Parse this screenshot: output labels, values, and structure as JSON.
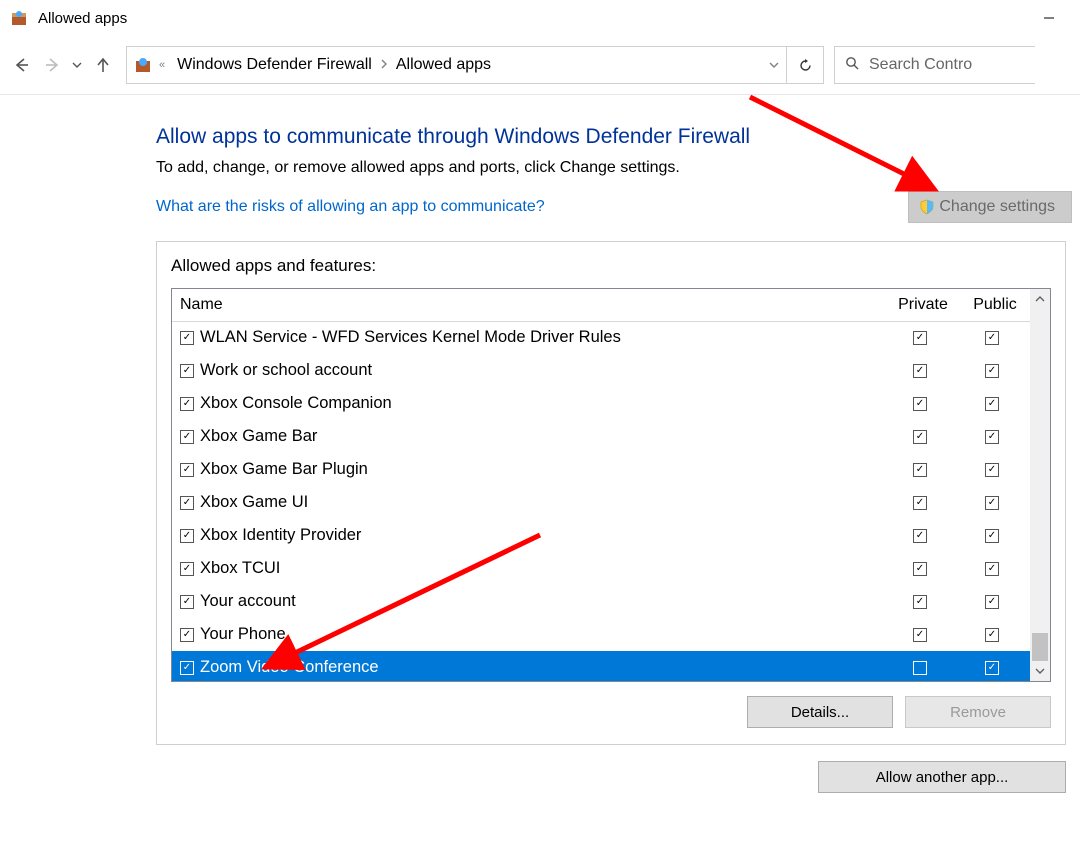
{
  "window": {
    "title": "Allowed apps"
  },
  "breadcrumb": {
    "item1": "Windows Defender Firewall",
    "item2": "Allowed apps"
  },
  "search": {
    "placeholder": "Search Contro"
  },
  "page": {
    "heading": "Allow apps to communicate through Windows Defender Firewall",
    "sub": "To add, change, or remove allowed apps and ports, click Change settings.",
    "risk_link": "What are the risks of allowing an app to communicate?",
    "change_settings": "Change settings"
  },
  "group": {
    "title": "Allowed apps and features:",
    "col_name": "Name",
    "col_private": "Private",
    "col_public": "Public"
  },
  "rows": [
    {
      "name": "WLAN Service - WFD Services Kernel Mode Driver Rules",
      "enabled": true,
      "private": true,
      "public": true,
      "selected": false
    },
    {
      "name": "Work or school account",
      "enabled": true,
      "private": true,
      "public": true,
      "selected": false
    },
    {
      "name": "Xbox Console Companion",
      "enabled": true,
      "private": true,
      "public": true,
      "selected": false
    },
    {
      "name": "Xbox Game Bar",
      "enabled": true,
      "private": true,
      "public": true,
      "selected": false
    },
    {
      "name": "Xbox Game Bar Plugin",
      "enabled": true,
      "private": true,
      "public": true,
      "selected": false
    },
    {
      "name": "Xbox Game UI",
      "enabled": true,
      "private": true,
      "public": true,
      "selected": false
    },
    {
      "name": "Xbox Identity Provider",
      "enabled": true,
      "private": true,
      "public": true,
      "selected": false
    },
    {
      "name": "Xbox TCUI",
      "enabled": true,
      "private": true,
      "public": true,
      "selected": false
    },
    {
      "name": "Your account",
      "enabled": true,
      "private": true,
      "public": true,
      "selected": false
    },
    {
      "name": "Your Phone",
      "enabled": true,
      "private": true,
      "public": true,
      "selected": false
    },
    {
      "name": "Zoom Video Conference",
      "enabled": true,
      "private": false,
      "public": true,
      "selected": true
    }
  ],
  "buttons": {
    "details": "Details...",
    "remove": "Remove",
    "allow_another": "Allow another app..."
  }
}
